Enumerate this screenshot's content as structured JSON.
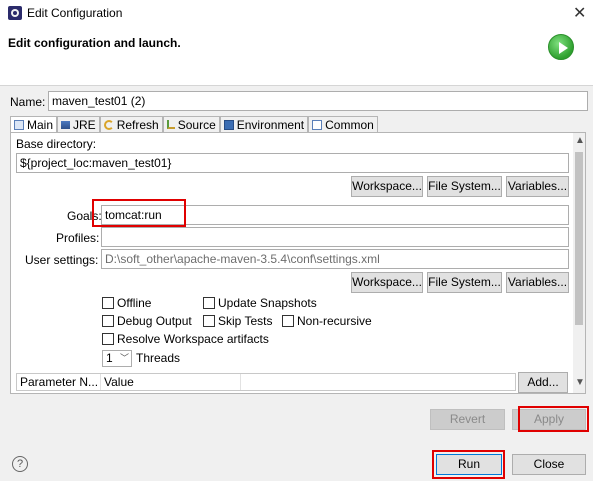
{
  "window": {
    "title": "Edit Configuration"
  },
  "banner": {
    "title": "Edit configuration and launch."
  },
  "name": {
    "label": "Name:",
    "value": "maven_test01 (2)"
  },
  "tabs": [
    {
      "label": "Main",
      "icon": "main-tab-icon",
      "active": true
    },
    {
      "label": "JRE",
      "icon": "jre-icon"
    },
    {
      "label": "Refresh",
      "icon": "refresh-icon"
    },
    {
      "label": "Source",
      "icon": "source-icon"
    },
    {
      "label": "Environment",
      "icon": "environment-icon"
    },
    {
      "label": "Common",
      "icon": "common-icon"
    }
  ],
  "main": {
    "base_dir_label": "Base directory:",
    "base_dir_value": "${project_loc:maven_test01}",
    "workspace_label": "Workspace...",
    "filesystem_label": "File System...",
    "variables_label": "Variables...",
    "goals_label": "Goals:",
    "goals_value": "tomcat:run",
    "profiles_label": "Profiles:",
    "profiles_value": "",
    "user_settings_label": "User settings:",
    "user_settings_value": "D:\\soft_other\\apache-maven-3.5.4\\conf\\settings.xml",
    "offline_label": "Offline",
    "update_snapshots_label": "Update Snapshots",
    "debug_output_label": "Debug Output",
    "skip_tests_label": "Skip Tests",
    "non_recursive_label": "Non-recursive",
    "resolve_label": "Resolve Workspace artifacts",
    "threads_value": "1",
    "threads_label": "Threads",
    "param_col_name": "Parameter N...",
    "param_col_value": "Value",
    "add_label": "Add..."
  },
  "actions": {
    "revert": "Revert",
    "apply": "Apply",
    "run": "Run",
    "close": "Close",
    "help": "?"
  },
  "colors": {
    "highlight": "#e00000",
    "run_icon": "#2ea02e"
  }
}
